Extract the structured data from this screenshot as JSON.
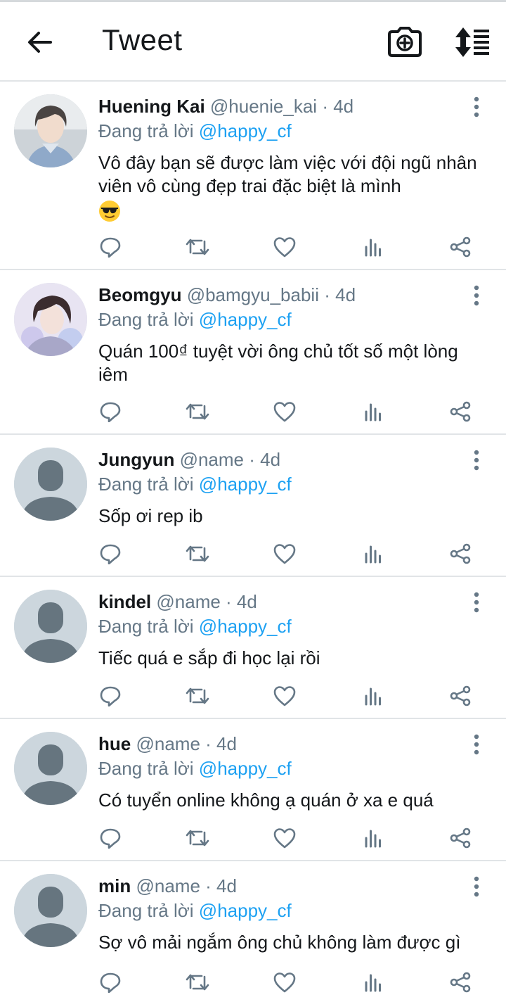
{
  "header": {
    "title": "Tweet",
    "back_icon": "arrow-left-icon",
    "camera_icon": "camera-plus-icon",
    "sort_icon": "sort-icon"
  },
  "reply_prefix": "Đang trả lời",
  "tweets": [
    {
      "name": "Huening Kai",
      "handle": "@huenie_kai",
      "time": "· 4d",
      "reply_to": "@happy_cf",
      "text": "Vô đây bạn sẽ được làm việc với đội ngũ nhân viên vô cùng đẹp trai đặc biệt là mình",
      "emoji": "smiling-face-with-sunglasses-emoji",
      "avatar": "profile-photo"
    },
    {
      "name": "Beomgyu",
      "handle": "@bamgyu_babii",
      "time": "· 4d",
      "reply_to": "@happy_cf",
      "text": "Quán 100₫ tuyệt vời ông chủ tốt số một lòng iêm",
      "avatar": "profile-photo"
    },
    {
      "name": "Jungyun",
      "handle": "@name",
      "time": "· 4d",
      "reply_to": "@happy_cf",
      "text": "Sốp ơi rep ib",
      "avatar": "default-avatar"
    },
    {
      "name": "kindel",
      "handle": "@name",
      "time": "· 4d",
      "reply_to": "@happy_cf",
      "text": "Tiếc quá e sắp đi học lại rồi",
      "avatar": "default-avatar"
    },
    {
      "name": "hue",
      "handle": "@name",
      "time": "· 4d",
      "reply_to": "@happy_cf",
      "text": "Có tuyển online không ạ quán ở xa e quá",
      "avatar": "default-avatar"
    },
    {
      "name": "min",
      "handle": "@name",
      "time": "· 4d",
      "reply_to": "@happy_cf",
      "text": "Sợ vô mải ngắm ông chủ không làm được gì",
      "avatar": "default-avatar"
    }
  ],
  "colors": {
    "mention": "#1da1f2",
    "secondary_text": "#657786",
    "divider": "#e1e4e7",
    "default_avatar_bg": "#ccd6dd",
    "default_avatar_fg": "#66757f"
  }
}
